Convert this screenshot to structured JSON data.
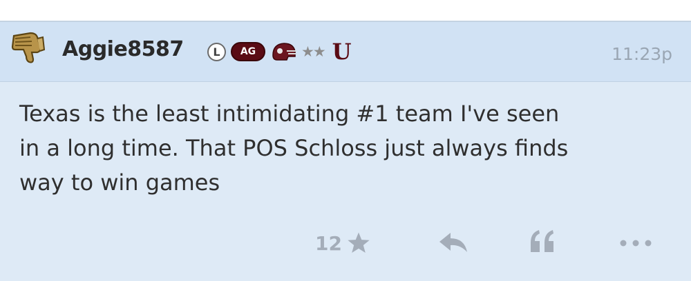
{
  "post": {
    "author": "Aggie8587",
    "badges": {
      "level": "L",
      "team": "AG",
      "stars": "★★",
      "tier": "U"
    },
    "time": "11:23p",
    "lines": [
      "Texas is the least intimidating #1 team I've seen",
      "in a long time. That POS Schloss just always finds",
      "way to win games"
    ],
    "like_count": "12"
  },
  "colors": {
    "header_bg": "#d1e2f4",
    "body_bg": "#deeaf6",
    "maroon": "#5a0b14",
    "muted": "#a4adb9"
  },
  "icons": {
    "avatar": "thumbs-down-hand-icon",
    "helmet": "helmet-icon",
    "like": "star-icon",
    "reply": "reply-arrow-icon",
    "quote": "quote-icon",
    "more": "ellipsis-icon"
  }
}
